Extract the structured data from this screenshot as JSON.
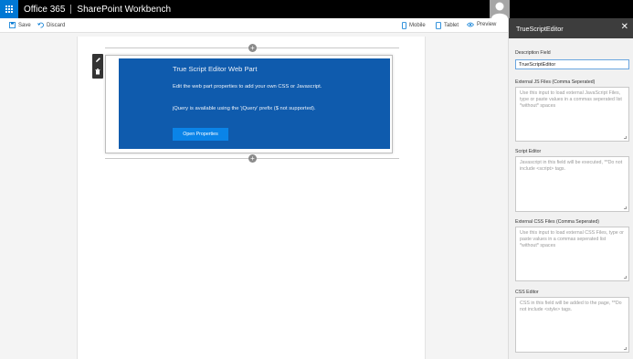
{
  "suite_bar": {
    "brand": "Office 365",
    "site_title": "SharePoint Workbench"
  },
  "command_bar": {
    "save_label": "Save",
    "discard_label": "Discard",
    "mobile_label": "Mobile",
    "tablet_label": "Tablet",
    "preview_label": "Preview"
  },
  "web_part": {
    "title": "True Script Editor Web Part",
    "description": "Edit the web part properties to add your own CSS or Javascript.",
    "jquery_note": "jQuery is available using the 'jQuery' prefix ($ not supported).",
    "button_label": "Open Properties",
    "accent_color": "#0f5bad"
  },
  "property_pane": {
    "title": "TrueScriptEditor",
    "description_label": "Description Field",
    "description_value": "TrueScriptEditor",
    "external_js_label": "External JS Files (Comma Seperated)",
    "external_js_placeholder": "Use this input to load external JavaScript Files, type or paste values in a commas seperated list *without* spaces",
    "script_editor_label": "Script Editor",
    "script_editor_placeholder": "Javascript in this field will be executed, **Do not include <script> tags.",
    "external_css_label": "External CSS Files (Comma Seperated)",
    "external_css_placeholder": "Use this input to load external CSS Files, type or paste values in a commas seperated list *without* spaces",
    "css_editor_label": "CSS Editor",
    "css_editor_placeholder": "CSS in this field will be added to the page, **Do not include <style> tags."
  }
}
